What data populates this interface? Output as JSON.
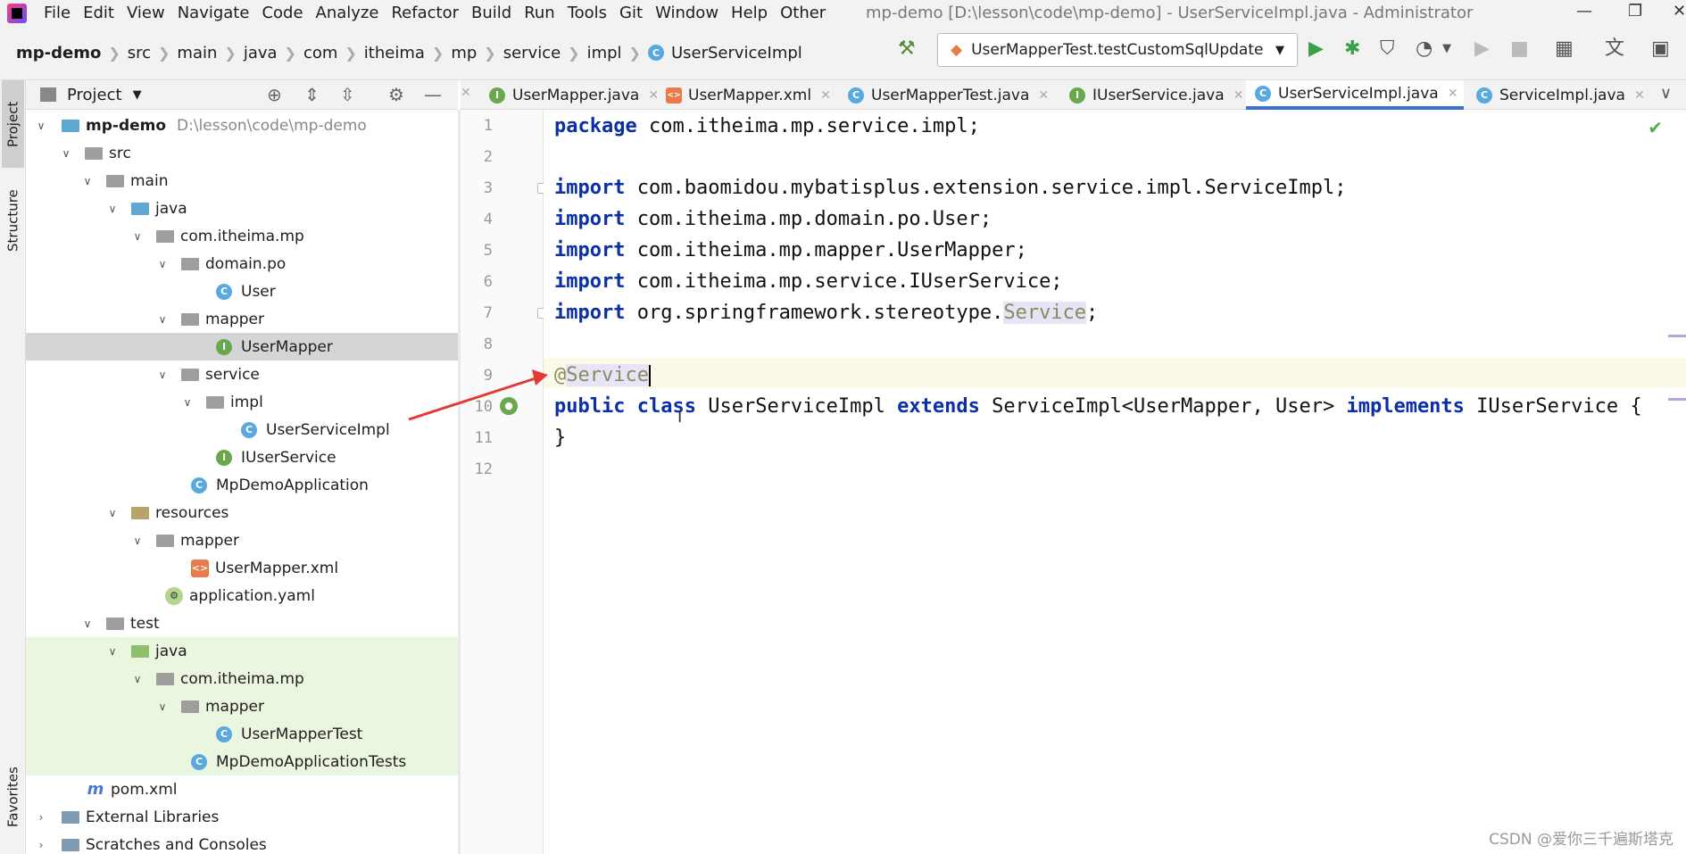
{
  "menubar": {
    "items": [
      "File",
      "Edit",
      "View",
      "Navigate",
      "Code",
      "Analyze",
      "Refactor",
      "Build",
      "Run",
      "Tools",
      "Git",
      "Window",
      "Help",
      "Other"
    ],
    "title": "mp-demo [D:\\lesson\\code\\mp-demo] - UserServiceImpl.java - Administrator"
  },
  "breadcrumb": [
    "mp-demo",
    "src",
    "main",
    "java",
    "com",
    "itheima",
    "mp",
    "service",
    "impl",
    "UserServiceImpl"
  ],
  "run_config": "UserMapperTest.testCustomSqlUpdate",
  "sidebar": {
    "tabs": [
      "Project",
      "Structure",
      "Favorites"
    ]
  },
  "project_header": {
    "label": "Project"
  },
  "tree": [
    {
      "label": "mp-demo",
      "extra": "D:\\lesson\\code\\mp-demo",
      "type": "module",
      "expanded": true
    },
    {
      "label": "src",
      "type": "folder",
      "expanded": true
    },
    {
      "label": "main",
      "type": "folder",
      "expanded": true
    },
    {
      "label": "java",
      "type": "source-folder",
      "expanded": true
    },
    {
      "label": "com.itheima.mp",
      "type": "package",
      "expanded": true
    },
    {
      "label": "domain.po",
      "type": "package",
      "expanded": true
    },
    {
      "label": "User",
      "type": "class"
    },
    {
      "label": "mapper",
      "type": "package",
      "expanded": true
    },
    {
      "label": "UserMapper",
      "type": "interface",
      "selected": true
    },
    {
      "label": "service",
      "type": "package",
      "expanded": true
    },
    {
      "label": "impl",
      "type": "package",
      "expanded": true
    },
    {
      "label": "UserServiceImpl",
      "type": "class"
    },
    {
      "label": "IUserService",
      "type": "interface"
    },
    {
      "label": "MpDemoApplication",
      "type": "spring-class"
    },
    {
      "label": "resources",
      "type": "resources-folder",
      "expanded": true
    },
    {
      "label": "mapper",
      "type": "folder",
      "expanded": true
    },
    {
      "label": "UserMapper.xml",
      "type": "xml"
    },
    {
      "label": "application.yaml",
      "type": "yaml"
    },
    {
      "label": "test",
      "type": "folder",
      "expanded": true
    },
    {
      "label": "java",
      "type": "test-folder",
      "expanded": true
    },
    {
      "label": "com.itheima.mp",
      "type": "package",
      "expanded": true
    },
    {
      "label": "mapper",
      "type": "package",
      "expanded": true
    },
    {
      "label": "UserMapperTest",
      "type": "test-class"
    },
    {
      "label": "MpDemoApplicationTests",
      "type": "test-class"
    },
    {
      "label": "pom.xml",
      "type": "maven"
    },
    {
      "label": "External Libraries",
      "type": "libraries",
      "expanded": false
    },
    {
      "label": "Scratches and Consoles",
      "type": "scratches",
      "expanded": false
    }
  ],
  "tabs": [
    {
      "label": "UserMapper.java",
      "icon": "I"
    },
    {
      "label": "UserMapper.xml",
      "icon": "xml"
    },
    {
      "label": "UserMapperTest.java",
      "icon": "C"
    },
    {
      "label": "IUserService.java",
      "icon": "I"
    },
    {
      "label": "UserServiceImpl.java",
      "icon": "C",
      "active": true
    },
    {
      "label": "ServiceImpl.java",
      "icon": "C"
    }
  ],
  "code": [
    "package com.itheima.mp.service.impl;",
    "",
    "import com.baomidou.mybatisplus.extension.service.impl.ServiceImpl;",
    "import com.itheima.mp.domain.po.User;",
    "import com.itheima.mp.mapper.UserMapper;",
    "import com.itheima.mp.service.IUserService;",
    "import org.springframework.stereotype.Service;",
    "",
    "@Service",
    "public class UserServiceImpl extends ServiceImpl<UserMapper, User> implements IUserService {",
    "}",
    ""
  ],
  "line_numbers": [
    "1",
    "2",
    "3",
    "4",
    "5",
    "6",
    "7",
    "8",
    "9",
    "10",
    "11",
    "12"
  ],
  "code_parts": {
    "l1_kw": "package",
    "l1_rest": " com.itheima.mp.service.impl;",
    "imp": "import",
    "l3_rest": " com.baomidou.mybatisplus.extension.service.impl.ServiceImpl;",
    "l4_rest": " com.itheima.mp.domain.po.User;",
    "l5_rest": " com.itheima.mp.mapper.UserMapper;",
    "l6_rest": " com.itheima.mp.service.IUserService;",
    "l7_pre": " org.springframework.stereotype.",
    "l7_hl": "Service",
    "l7_end": ";",
    "l9_at": "@",
    "l9_ann": "Service",
    "public": "public",
    "class": "class",
    "extends": "extends",
    "implements": "implements",
    "l10_name": " UserServiceImpl ",
    "l10_super": " ServiceImpl<UserMapper, User> ",
    "l10_iface": " IUserService {",
    "l11": "}"
  },
  "watermark": "CSDN @爱你三千遍斯塔克",
  "colors": {
    "keyword": "#0b2fa5",
    "annotation": "#8a8a5c",
    "arrow": "#e53935",
    "accent": "#3b6fd2",
    "test_bg": "#eaf6e0"
  }
}
